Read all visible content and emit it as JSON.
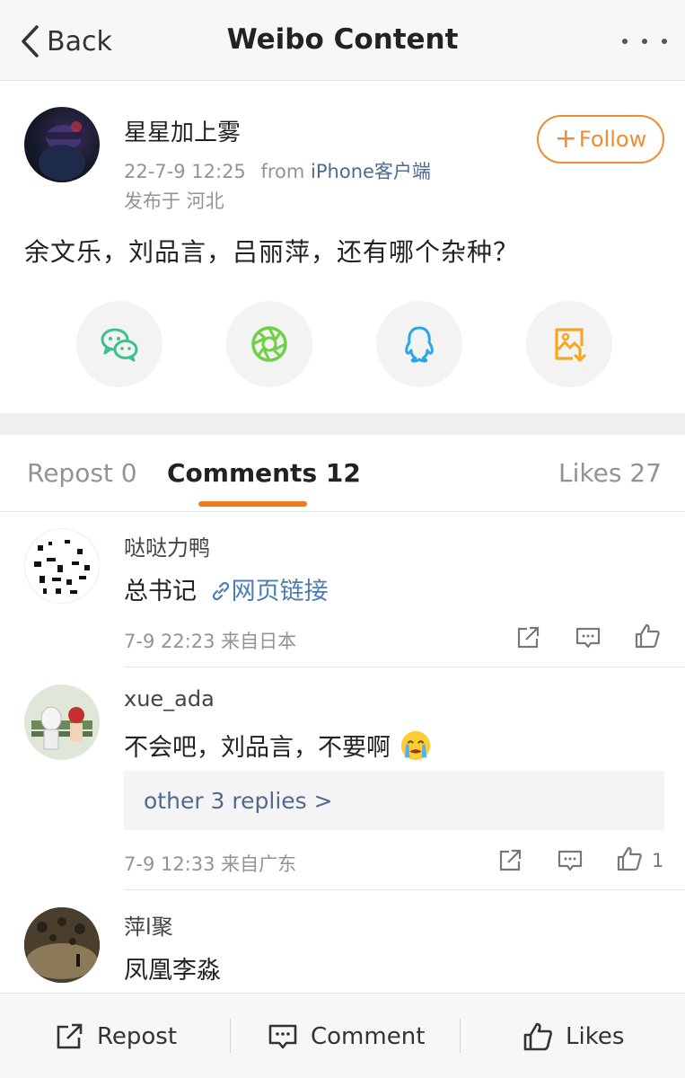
{
  "nav": {
    "back_label": "Back",
    "title": "Weibo Content",
    "more_icon": "more-icon"
  },
  "post": {
    "author": "星星加上雾",
    "time": "22-7-9 12:25",
    "from_label": "from",
    "source": "iPhone客户端",
    "location": "发布于 河北",
    "follow_label": "Follow",
    "text": "余文乐，刘品言，吕丽萍，还有哪个杂种？",
    "share_icons": [
      "wechat-icon",
      "moments-icon",
      "qq-icon",
      "save-image-icon"
    ]
  },
  "colors": {
    "accent": "#f07b1d",
    "follow": "#f08c2e",
    "link": "#506a8f",
    "wechat": "#3cc18a",
    "moments": "#6fcf45",
    "qq": "#2aa6e8",
    "save": "#f5a623"
  },
  "tabs": [
    {
      "label": "Repost 0"
    },
    {
      "label": "Comments 12"
    },
    {
      "label": "Likes 27"
    }
  ],
  "comments": [
    {
      "name": "哒哒力鸭",
      "text": "总书记",
      "link_text": "网页链接",
      "time": "7-9 22:23 来自日本",
      "likes": ""
    },
    {
      "name": "xue_ada",
      "text": "不会吧，刘品言，不要啊",
      "emoji": "crying-emoji",
      "replies": "other 3 replies >",
      "time": "7-9 12:33 来自广东",
      "likes": "1"
    },
    {
      "name": "萍l聚",
      "text": "凤凰李淼"
    }
  ],
  "bottom_bar": {
    "repost": "Repost",
    "comment": "Comment",
    "likes": "Likes"
  }
}
